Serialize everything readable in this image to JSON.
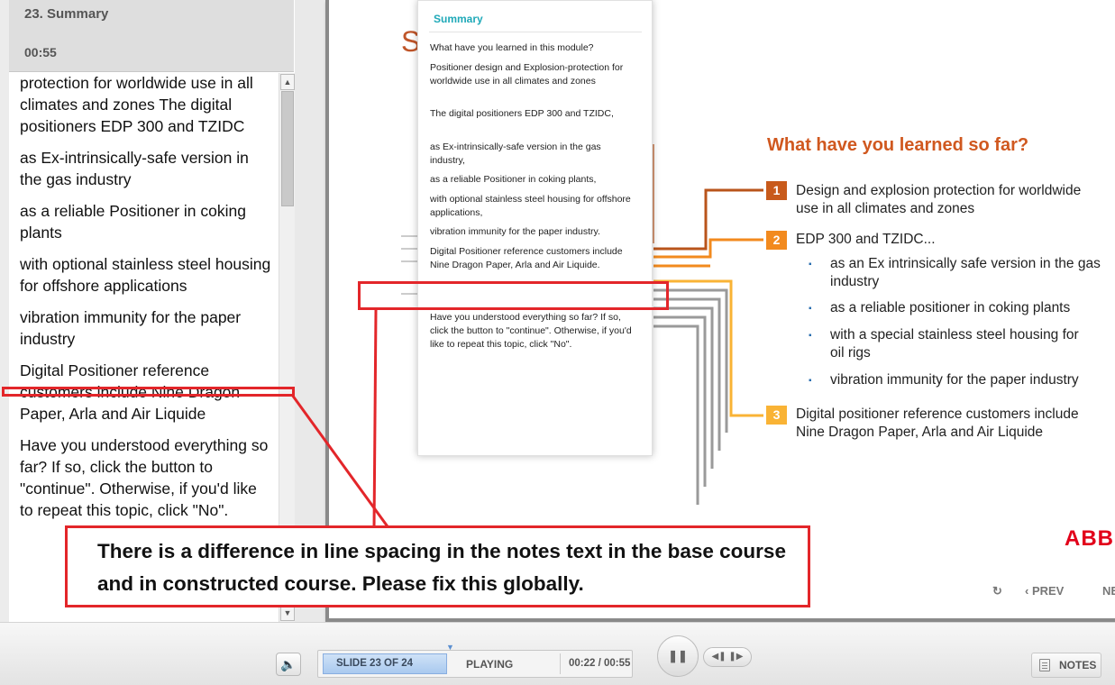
{
  "sidebar": {
    "slide_title": "23. Summary",
    "duration": "00:55",
    "notes": [
      "Positioner design and Explosion-protection for worldwide use in all climates and zones The digital positioners EDP 300 and TZIDC",
      "as Ex-intrinsically-safe version in the gas industry",
      "as a reliable Positioner in coking plants",
      "with optional stainless steel housing for offshore applications",
      "vibration immunity for the paper industry",
      "Digital Positioner reference customers include Nine Dragon Paper, Arla and Air Liquide",
      "Have you understood everything so far? If so, click the button to \"continue\". Otherwise, if you'd like to repeat this topic, click \"No\"."
    ]
  },
  "popup": {
    "heading": "Summary",
    "lines": [
      "What have you learned in this module?",
      "Positioner design and Explosion-protection for worldwide use in all climates and zones",
      "The digital positioners EDP 300 and TZIDC,",
      "as Ex-intrinsically-safe version in the gas industry,",
      "as a reliable Positioner in coking plants,",
      "with optional stainless steel housing for offshore applications,",
      "vibration immunity for the paper industry.",
      "Digital Positioner reference customers include Nine Dragon Paper, Arla and Air Liquide.",
      "Have you understood everything so far? If so, click the button to \"continue\". Otherwise, if you'd like to repeat this topic, click \"No\"."
    ]
  },
  "slide": {
    "title_letter": "S",
    "heading": "What have you learned so far?",
    "points": [
      {
        "num": "1",
        "color": "#c85a1b",
        "text": "Design and explosion protection for worldwide use in all climates and zones"
      },
      {
        "num": "2",
        "color": "#f28a1e",
        "text": "EDP 300 and TZIDC..."
      },
      {
        "num": "3",
        "color": "#f9b335",
        "text": "Digital positioner reference customers include Nine Dragon Paper, Arla and Air Liquide"
      }
    ],
    "subpoints": [
      "as an Ex intrinsically safe version in the gas industry",
      "as a reliable positioner in coking plants",
      "with a special stainless steel housing for oil rigs",
      "vibration immunity for the paper industry"
    ],
    "logo": "ABB",
    "nav_prev": "PREV",
    "nav_next": "NEXT",
    "bullet_color": "#2b6fb0"
  },
  "annotation": {
    "text": "There is a difference in line spacing in the notes text in the base course and in constructed course. Please fix this globally.",
    "color": "#e3262a"
  },
  "player": {
    "slide_counter": "SLIDE 23 OF 24",
    "state": "PLAYING",
    "time": "00:22 / 00:55",
    "notes_label": "NOTES"
  }
}
